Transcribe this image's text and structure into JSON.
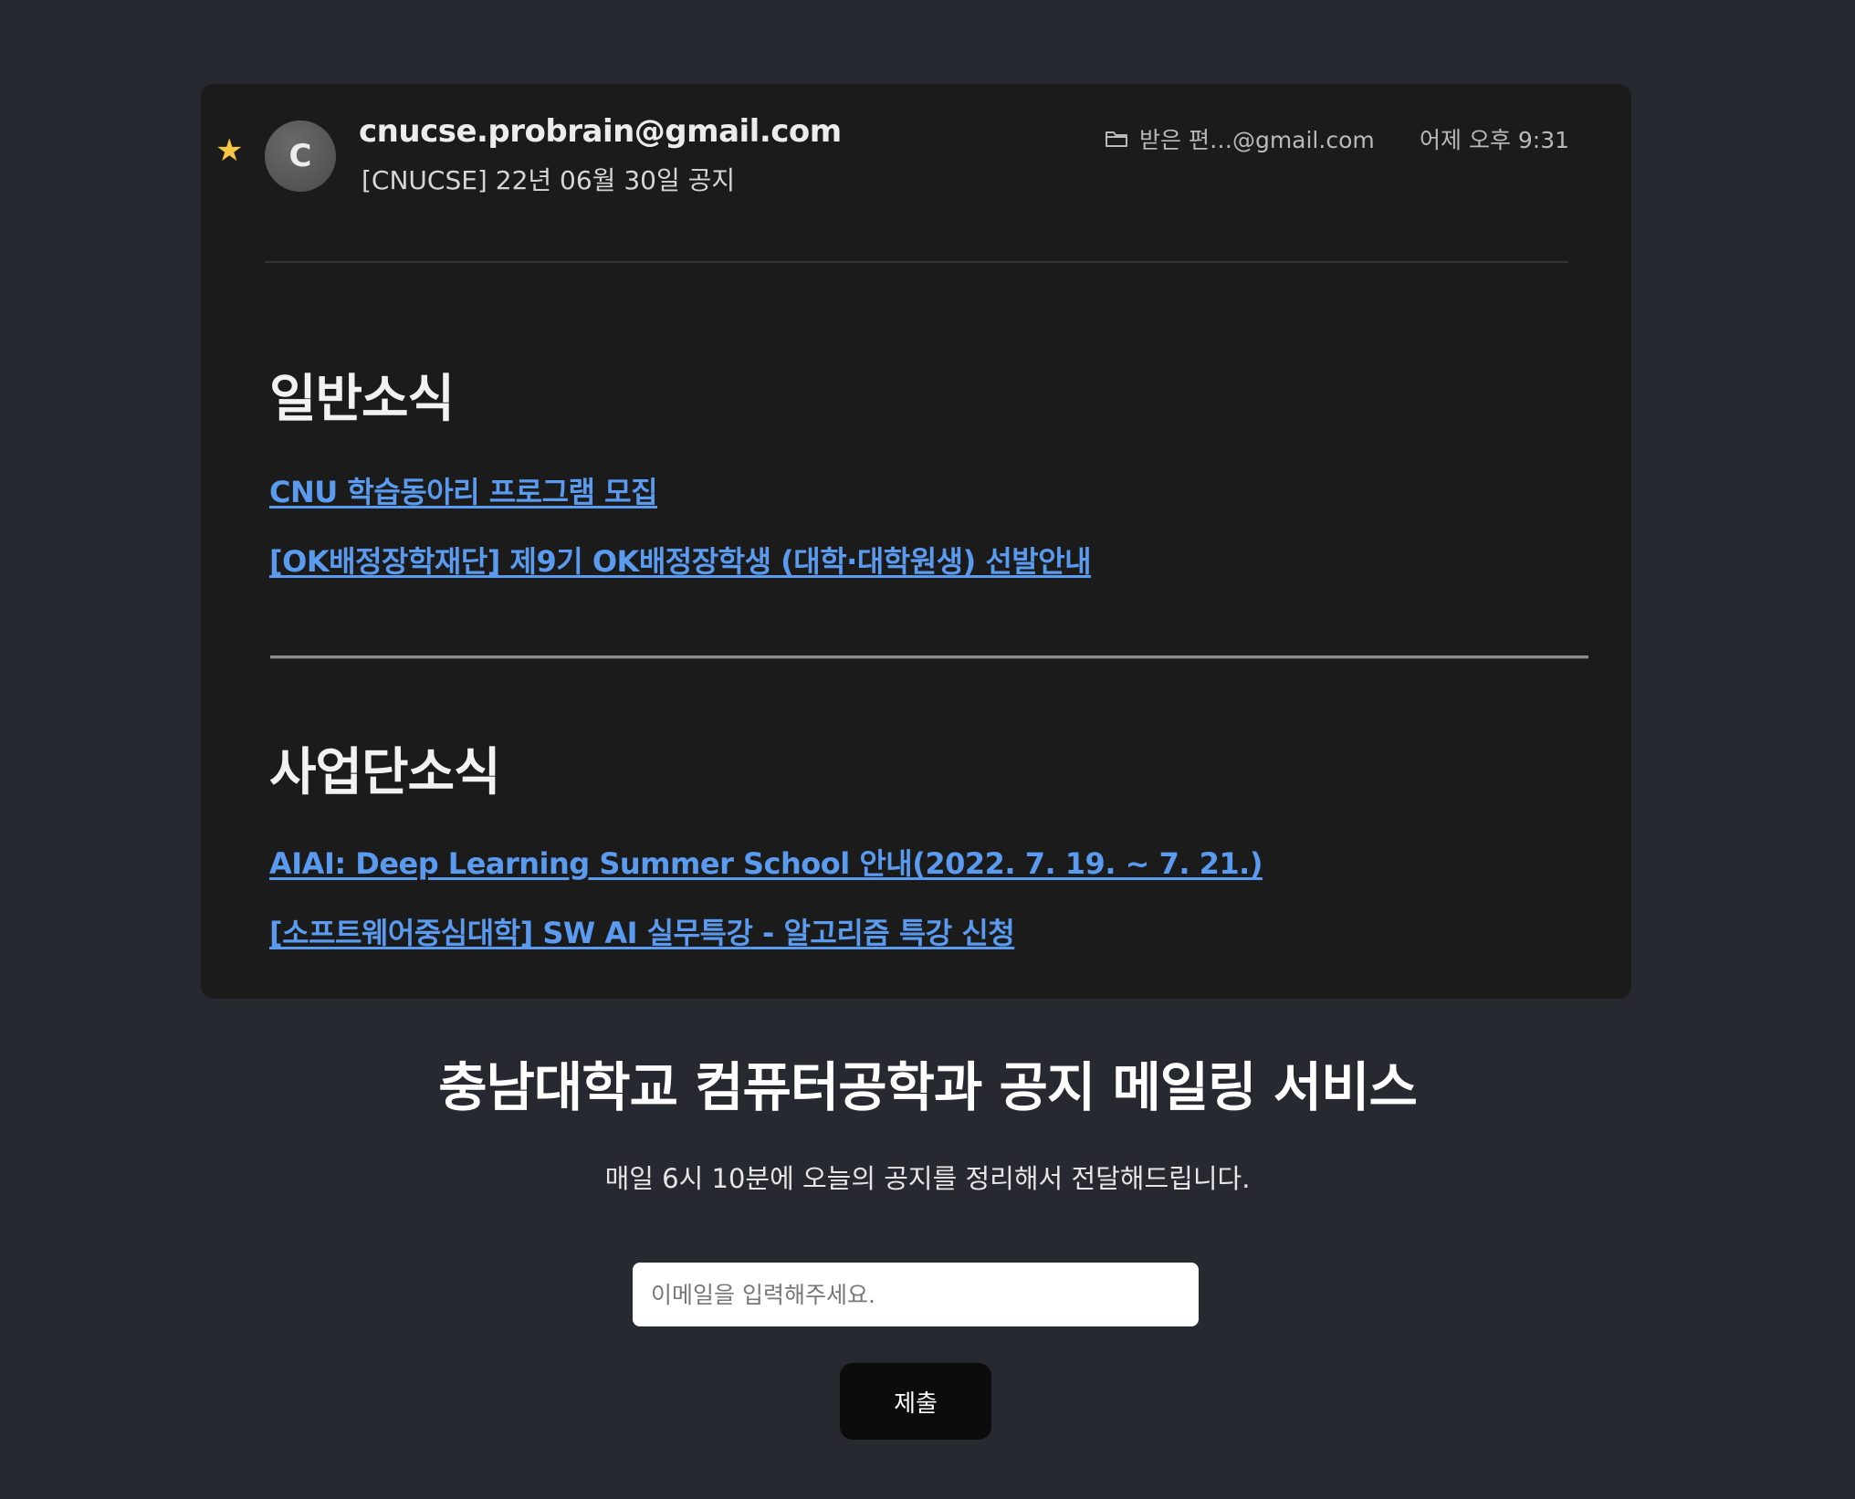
{
  "email": {
    "sender": "cnucse.probrain@gmail.com",
    "avatar_letter": "C",
    "subject": "[CNUCSE] 22년 06월 30일 공지",
    "folder_label": "받은 편…@gmail.com",
    "datetime": "어제 오후 9:31",
    "starred": true,
    "star_color": "#f6c644"
  },
  "sections": [
    {
      "title": "일반소식",
      "links": [
        "CNU 학습동아리 프로그램 모집",
        "[OK배정장학재단] 제9기 OK배정장학생 (대학·대학원생) 선발안내"
      ]
    },
    {
      "title": "사업단소식",
      "links": [
        "AIAI: Deep Learning Summer School 안내(2022. 7. 19. ~ 7. 21.)",
        "[소프트웨어중심대학] SW AI 실무특강 - 알고리즘 특강 신청"
      ]
    }
  ],
  "service": {
    "title": "충남대학교 컴퓨터공학과 공지 메일링 서비스",
    "subtitle": "매일 6시 10분에 오늘의 공지를 정리해서 전달해드립니다.",
    "email_placeholder": "이메일을 입력해주세요.",
    "email_value": "",
    "submit_label": "제출"
  },
  "colors": {
    "page_background": "#272930",
    "card_background": "#1b1b1c",
    "link": "#5a9bf0"
  }
}
